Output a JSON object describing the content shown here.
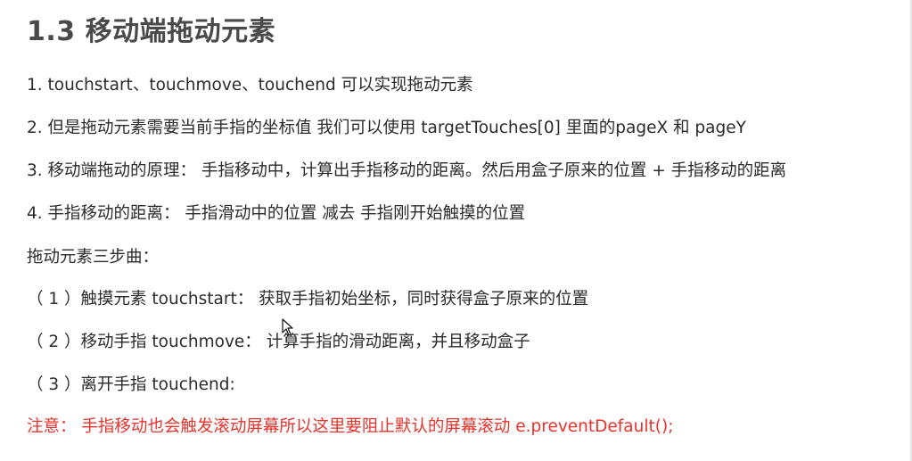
{
  "title": "1.3 移动端拖动元素",
  "lines": [
    "1. touchstart、touchmove、touchend 可以实现拖动元素",
    "2. 但是拖动元素需要当前手指的坐标值 我们可以使用  targetTouches[0] 里面的pageX 和 pageY",
    "3. 移动端拖动的原理：    手指移动中，计算出手指移动的距离。然后用盒子原来的位置 + 手指移动的距离",
    "4. 手指移动的距离：   手指滑动中的位置 减去  手指刚开始触摸的位置",
    "拖动元素三步曲：",
    "（ 1 ）触摸元素 touchstart：  获取手指初始坐标，同时获得盒子原来的位置",
    "（ 2 ）移动手指 touchmove：  计算手指的滑动距离，并且移动盒子",
    "（ 3 ）离开手指 touchend:"
  ],
  "note": "注意：  手指移动也会触发滚动屏幕所以这里要阻止默认的屏幕滚动 e.preventDefault();",
  "colors": {
    "note": "#e8322b",
    "title": "#4a4a4a",
    "text": "#2b2b2b"
  },
  "icons": [
    "mouse-cursor-icon"
  ]
}
